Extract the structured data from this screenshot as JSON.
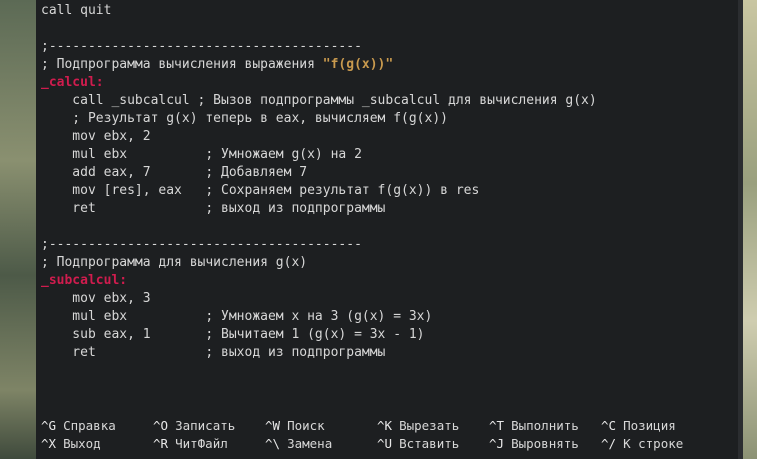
{
  "editor": {
    "lines": [
      {
        "text": "call quit"
      },
      {
        "text": ""
      },
      {
        "text": ";----------------------------------------"
      },
      {
        "text": "; Подпрограмма вычисления выражения ",
        "highlight": "\"f(g(x))\""
      },
      {
        "label": "_calcul:"
      },
      {
        "text": "    call _subcalcul ; Вызов подпрограммы _subcalcul для вычисления g(x)"
      },
      {
        "text": "    ; Результат g(x) теперь в eax, вычисляем f(g(x))"
      },
      {
        "text": "    mov ebx, 2"
      },
      {
        "text": "    mul ebx          ; Умножаем g(x) на 2"
      },
      {
        "text": "    add eax, 7       ; Добавляем 7"
      },
      {
        "text": "    mov [res], eax   ; Сохраняем результат f(g(x)) в res"
      },
      {
        "text": "    ret              ; выход из подпрограммы"
      },
      {
        "text": ""
      },
      {
        "text": ";----------------------------------------"
      },
      {
        "text": "; Подпрограмма для вычисления g(x)"
      },
      {
        "label": "_subcalcul:"
      },
      {
        "text": "    mov ebx, 3"
      },
      {
        "text": "    mul ebx          ; Умножаем x на 3 (g(x) = 3x)"
      },
      {
        "text": "    sub eax, 1       ; Вычитаем 1 (g(x) = 3x - 1)"
      },
      {
        "text": "    ret              ; выход из подпрограммы"
      }
    ]
  },
  "shortcuts": {
    "row1": [
      {
        "key": "^G",
        "label": "Справка",
        "icon": "help-icon"
      },
      {
        "key": "^O",
        "label": "Записать",
        "icon": "write-out-icon"
      },
      {
        "key": "^W",
        "label": "Поиск",
        "icon": "search-icon"
      },
      {
        "key": "^K",
        "label": "Вырезать",
        "icon": "cut-icon"
      },
      {
        "key": "^T",
        "label": "Выполнить",
        "icon": "execute-icon"
      },
      {
        "key": "^C",
        "label": "Позиция",
        "icon": "location-icon"
      }
    ],
    "row2": [
      {
        "key": "^X",
        "label": "Выход",
        "icon": "exit-icon"
      },
      {
        "key": "^R",
        "label": "ЧитФайл",
        "icon": "read-file-icon"
      },
      {
        "key": "^\\",
        "label": "Замена",
        "icon": "replace-icon"
      },
      {
        "key": "^U",
        "label": "Вставить",
        "icon": "paste-icon"
      },
      {
        "key": "^J",
        "label": "Выровнять",
        "icon": "justify-icon"
      },
      {
        "key": "^/",
        "label": "К строке",
        "icon": "go-to-line-icon"
      }
    ]
  },
  "colors": {
    "background": "#1d1f21",
    "text": "#d7d7d7",
    "label": "#d01c4e",
    "string": "#c99a4e"
  }
}
